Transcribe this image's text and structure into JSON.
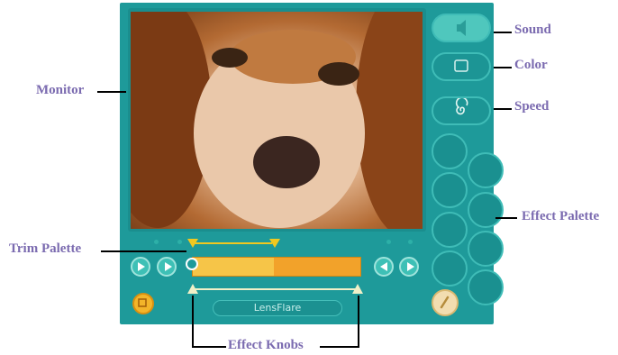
{
  "callouts": {
    "sound": "Sound",
    "color": "Color",
    "speed": "Speed",
    "monitor": "Monitor",
    "effect_palette": "Effect Palette",
    "trim_palette": "Trim Palette",
    "effect_knobs": "Effect Knobs"
  },
  "effect": {
    "name": "LensFlare"
  },
  "icons": {
    "sound": "speaker-icon",
    "color": "square-icon",
    "speed": "spiral-icon",
    "play": "play-icon",
    "play_selection": "play-selection-icon",
    "step_back": "step-back-icon",
    "step_forward": "step-forward-icon",
    "undo": "undo-icon",
    "apply": "apply-effect-icon"
  },
  "colors": {
    "panel": "#1e9a9a",
    "accent_yellow": "#f2a22a",
    "label_purple": "#7b6bb0"
  }
}
